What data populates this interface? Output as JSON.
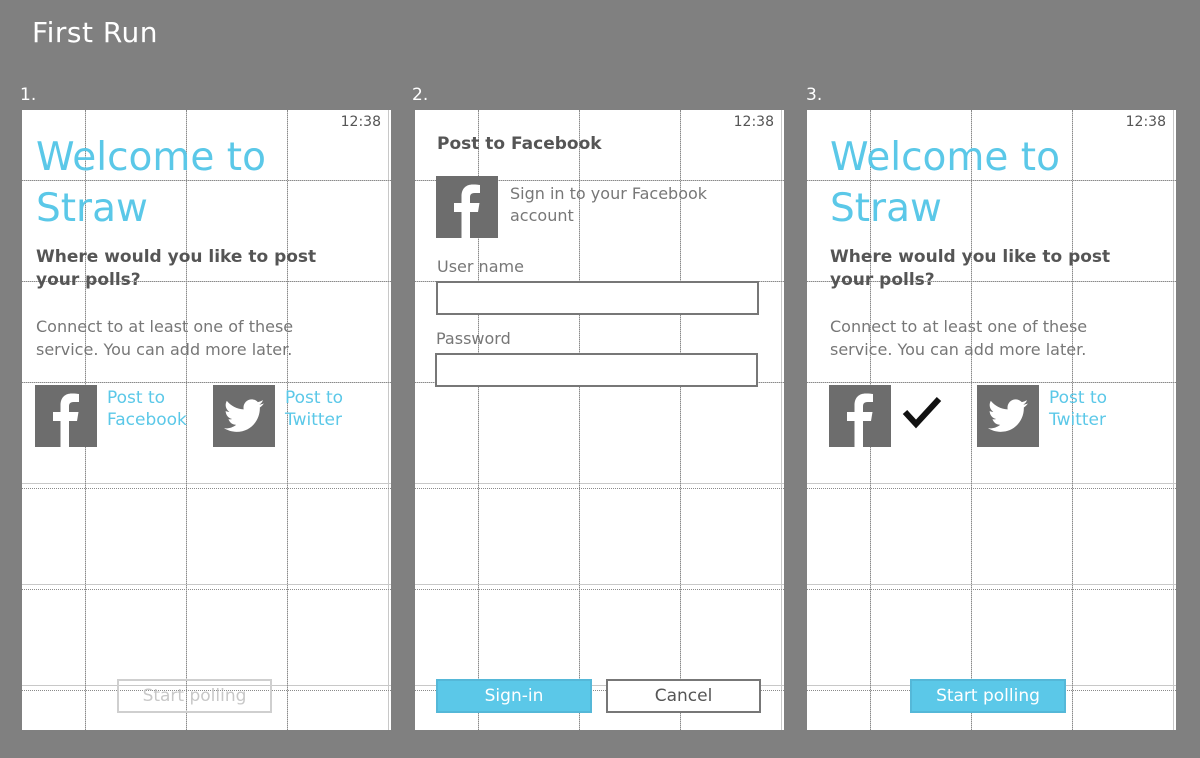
{
  "page_title": "First Run",
  "steps": [
    {
      "number": "1.",
      "clock": "12:38",
      "welcome": "Welcome to Straw",
      "question": "Where would you like to post your polls?",
      "description": "Connect to at least one of these service. You can add more later.",
      "facebook_label": "Post to Facebook",
      "twitter_label": "Post to Twitter",
      "start_button": "Start polling"
    },
    {
      "number": "2.",
      "clock": "12:38",
      "title": "Post to Facebook",
      "signin_text": "Sign in to your Facebook account",
      "username_label": "User name",
      "username_value": "",
      "password_label": "Password",
      "password_value": "",
      "signin_button": "Sign-in",
      "cancel_button": "Cancel"
    },
    {
      "number": "3.",
      "clock": "12:38",
      "welcome": "Welcome to Straw",
      "question": "Where would you like to post your polls?",
      "description": "Connect to at least one of these service. You can add more later.",
      "twitter_label": "Post to Twitter",
      "start_button": "Start polling"
    }
  ],
  "colors": {
    "background": "#808080",
    "accent": "#5bc8e8",
    "tile": "#6d6d6d"
  },
  "icons": [
    "facebook-icon",
    "twitter-icon",
    "checkmark-icon"
  ]
}
